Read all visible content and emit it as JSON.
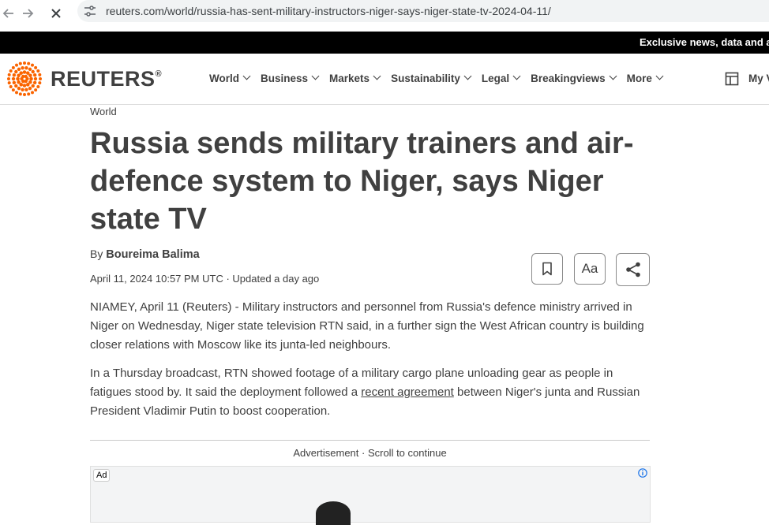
{
  "browser": {
    "back_icon": "arrow-left-icon",
    "forward_icon": "arrow-right-icon",
    "stop_icon": "close-icon",
    "url": "reuters.com/world/russia-has-sent-military-instructors-niger-says-niger-state-tv-2024-04-11/"
  },
  "banner": {
    "text": "Exclusive news, data and a"
  },
  "header": {
    "logo_text": "REUTERS",
    "logo_reg": "®",
    "nav": [
      {
        "label": "World"
      },
      {
        "label": "Business"
      },
      {
        "label": "Markets"
      },
      {
        "label": "Sustainability"
      },
      {
        "label": "Legal"
      },
      {
        "label": "Breakingviews"
      },
      {
        "label": "More"
      }
    ],
    "my_view": "My V"
  },
  "article": {
    "section": "World",
    "headline": "Russia sends military trainers and air-defence system to Niger, says Niger state TV",
    "by": "By",
    "author": "Boureima Balima",
    "dateline": "April 11, 2024 10:57 PM UTC · Updated a day ago",
    "tools": {
      "bookmark_icon": "bookmark-icon",
      "text_size_label": "Aa",
      "share_icon": "share-icon"
    },
    "p1": "NIAMEY, April 11 (Reuters) - Military instructors and personnel from Russia's defence ministry arrived in Niger on Wednesday, Niger state television RTN said, in a further sign the West African country is building closer relations with Moscow like its junta-led neighbours.",
    "p2_before": "In a Thursday broadcast, RTN showed footage of a military cargo plane unloading gear as people in fatigues stood by. It said the deployment followed a ",
    "p2_link": "recent agreement",
    "p2_after": " between Niger's junta and Russian President Vladimir Putin to boost cooperation."
  },
  "ad": {
    "label": "Advertisement · Scroll to continue",
    "tag": "Ad"
  },
  "colors": {
    "brand_orange": "#fa6400",
    "text": "#404040",
    "banner": "#000000"
  }
}
